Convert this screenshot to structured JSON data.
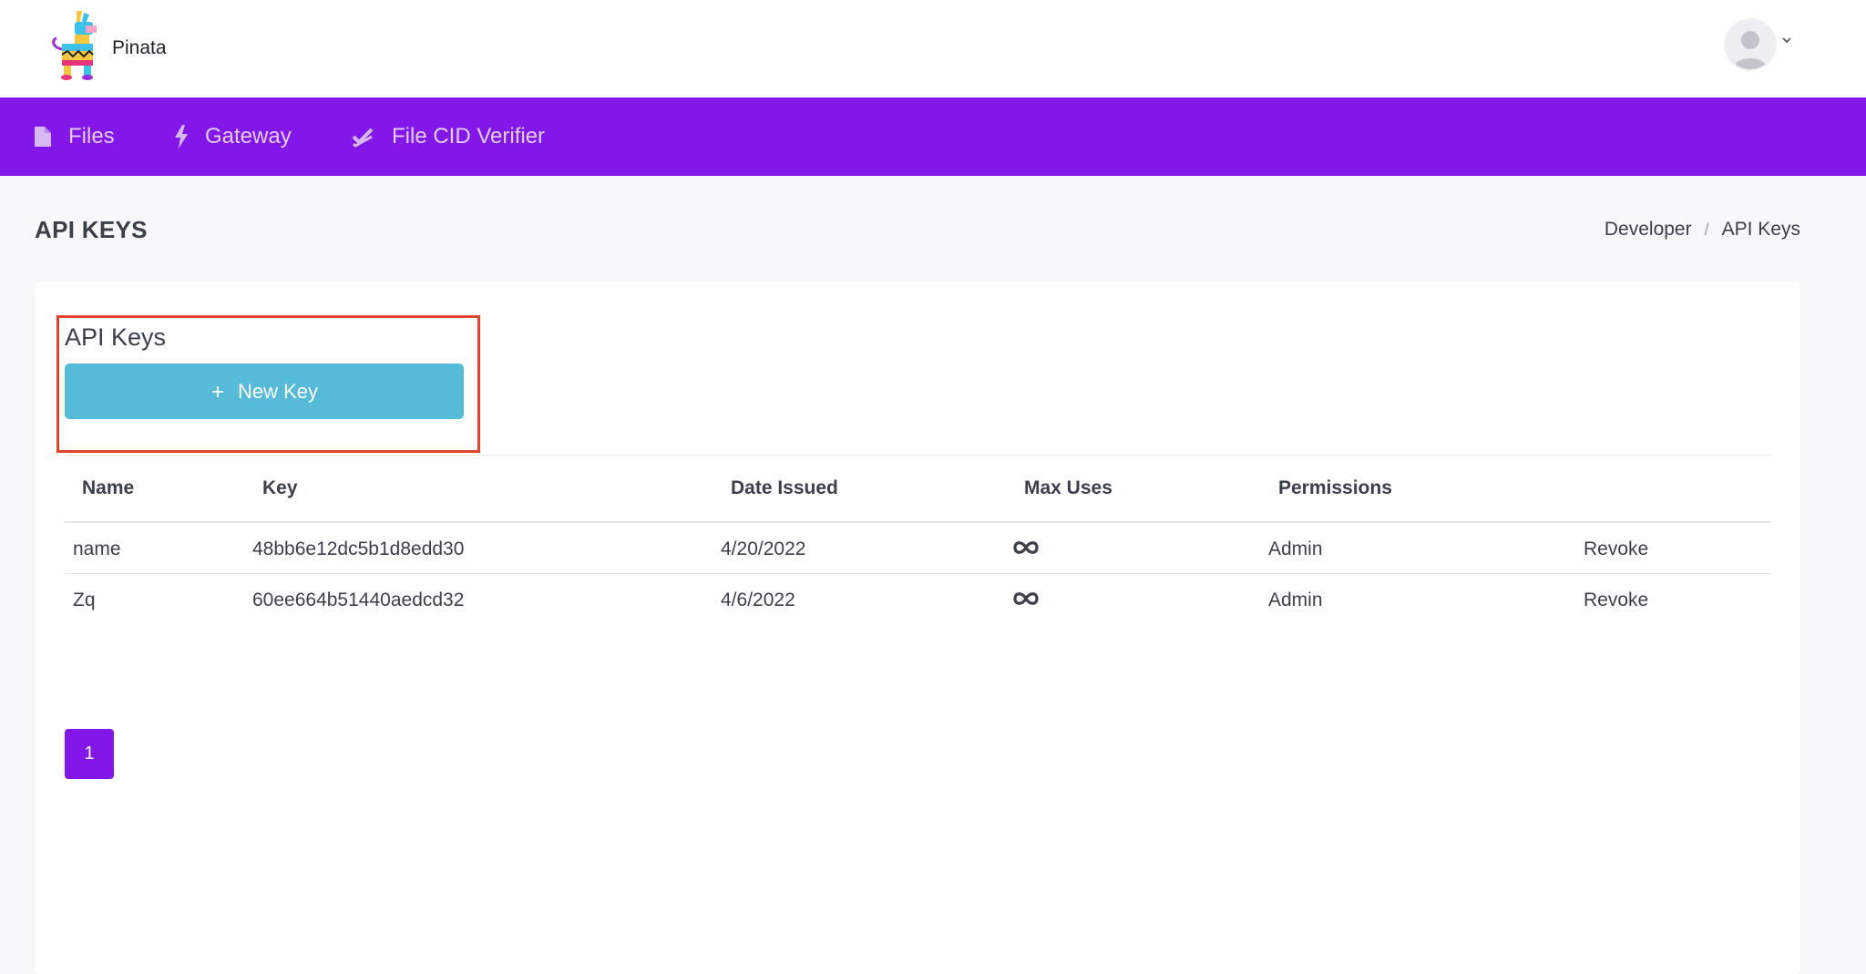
{
  "header": {
    "brand": "Pinata",
    "logo_icon": "pinata-llama-logo",
    "avatar_icon": "user-avatar-icon"
  },
  "nav": {
    "items": [
      {
        "label": "Files",
        "icon": "file-icon"
      },
      {
        "label": "Gateway",
        "icon": "bolt-icon"
      },
      {
        "label": "File CID Verifier",
        "icon": "double-check-icon"
      }
    ]
  },
  "page": {
    "title": "API KEYS",
    "breadcrumb": [
      "Developer",
      "API Keys"
    ]
  },
  "card": {
    "title": "API Keys",
    "new_key_label": "New Key",
    "table": {
      "headers": [
        "Name",
        "Key",
        "Date Issued",
        "Max Uses",
        "Permissions"
      ],
      "rows": [
        {
          "name": "name",
          "key": "48bb6e12dc5b1d8edd30",
          "date": "4/20/2022",
          "max_uses_icon": "infinity-icon",
          "permissions": "Admin",
          "action": "Revoke"
        },
        {
          "name": "Zq",
          "key": "60ee664b51440aedcd32",
          "date": "4/6/2022",
          "max_uses_icon": "infinity-icon",
          "permissions": "Admin",
          "action": "Revoke"
        }
      ]
    },
    "pagination": {
      "current": "1"
    }
  },
  "colors": {
    "nav_bg": "#8316e8",
    "button_bg": "#56bbd8",
    "highlight": "#e2432d"
  }
}
